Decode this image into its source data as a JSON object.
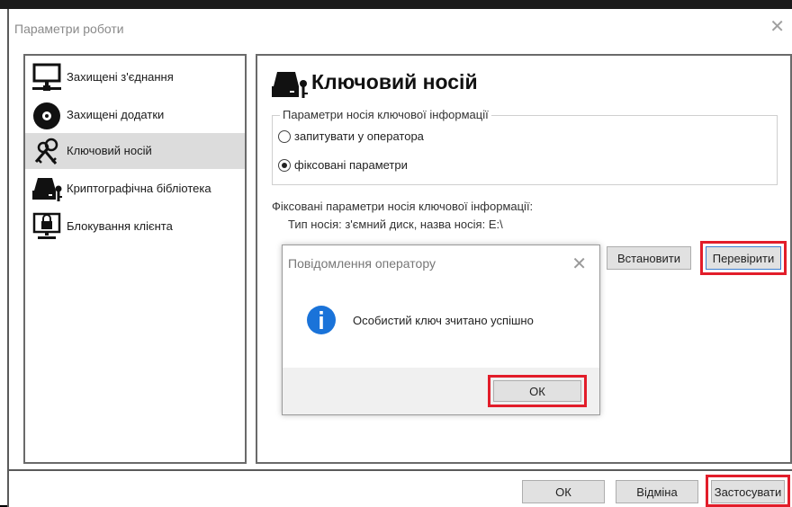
{
  "window": {
    "title": "Параметри роботи",
    "close_icon": "close-icon"
  },
  "sidebar": {
    "items": [
      {
        "label": "Захищені з'єднання",
        "icon": "monitor-network-icon"
      },
      {
        "label": "Захищені додатки",
        "icon": "disc-icon"
      },
      {
        "label": "Ключовий носій",
        "icon": "keys-icon",
        "selected": true
      },
      {
        "label": "Криптографічна бібліотека",
        "icon": "drive-key-icon"
      },
      {
        "label": "Блокування клієнта",
        "icon": "monitor-lock-icon"
      }
    ]
  },
  "main": {
    "title": "Ключовий носій",
    "title_icon": "drive-key-icon",
    "group": {
      "legend": "Параметри носія ключової інформації",
      "options": [
        {
          "label": "запитувати у оператора",
          "selected": false
        },
        {
          "label": "фіксовані параметри",
          "selected": true
        }
      ]
    },
    "fixed_heading": "Фіксовані параметри носія ключової інформації:",
    "carrier_type": "Тип носія: з'ємний диск, назва носія: E:\\",
    "set_button": "Встановити",
    "check_button": "Перевірити"
  },
  "dialog": {
    "title": "Повідомлення оператору",
    "message": "Особистий ключ зчитано успішно",
    "ok": "ОК",
    "icon": "info-icon"
  },
  "footer": {
    "ok": "ОК",
    "cancel": "Відміна",
    "apply": "Застосувати"
  },
  "colors": {
    "highlight": "#e21d2a",
    "info_blue": "#1a73d9",
    "selected_bg": "#dcdcdc"
  }
}
